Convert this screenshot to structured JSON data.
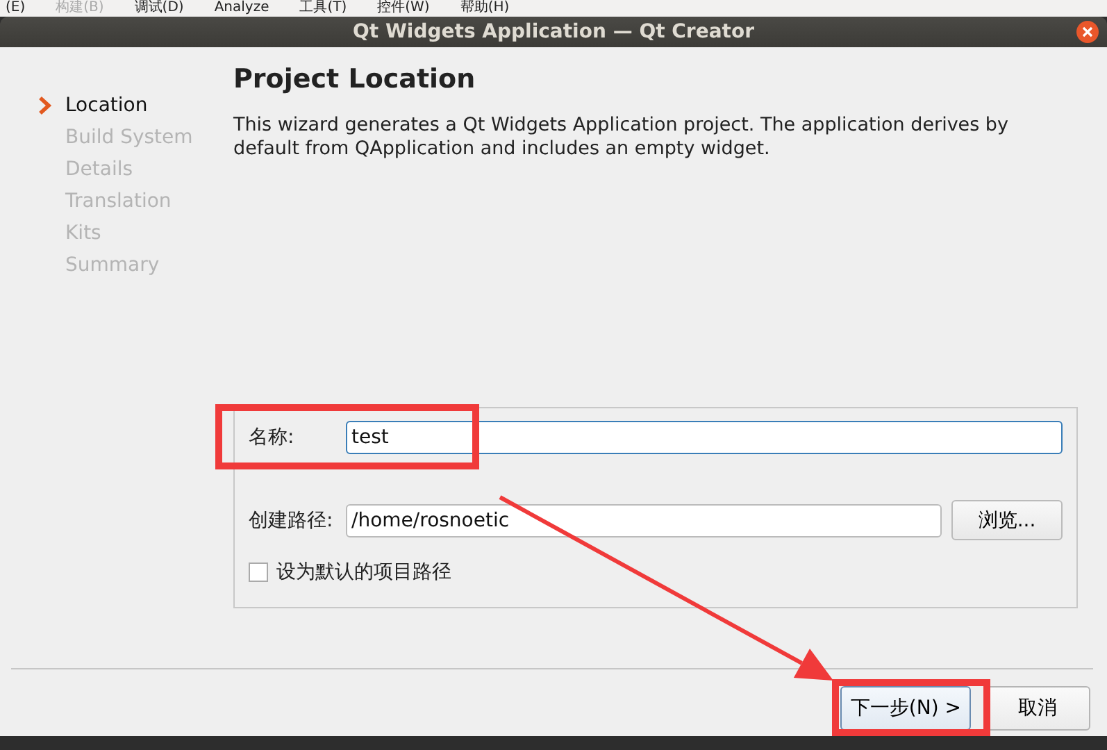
{
  "menu_bar": [
    {
      "label": "(E)",
      "disabled": false
    },
    {
      "label": "构建(B)",
      "disabled": true
    },
    {
      "label": "调试(D)",
      "disabled": false
    },
    {
      "label": "Analyze",
      "disabled": false
    },
    {
      "label": "工具(T)",
      "disabled": false
    },
    {
      "label": "控件(W)",
      "disabled": false
    },
    {
      "label": "帮助(H)",
      "disabled": false
    }
  ],
  "window": {
    "title": "Qt Widgets Application — Qt Creator"
  },
  "steps": [
    {
      "label": "Location",
      "selected": true
    },
    {
      "label": "Build System",
      "selected": false
    },
    {
      "label": "Details",
      "selected": false
    },
    {
      "label": "Translation",
      "selected": false
    },
    {
      "label": "Kits",
      "selected": false
    },
    {
      "label": "Summary",
      "selected": false
    }
  ],
  "page": {
    "heading": "Project Location",
    "description": "This wizard generates a Qt Widgets Application project. The application derives by default from QApplication and includes an empty widget."
  },
  "form": {
    "name_label": "名称:",
    "name_value": "test",
    "path_label": "创建路径:",
    "path_value": "/home/rosnoetic",
    "browse_button": "浏览...",
    "default_checkbox": {
      "label": "设为默认的项目路径",
      "checked": false
    }
  },
  "buttons": [
    {
      "label": "下一步(N) >",
      "kind": "default"
    },
    {
      "label": "取消",
      "kind": "normal"
    }
  ],
  "annotations": [
    {
      "kind": "box",
      "color": "#f03a3a"
    },
    {
      "kind": "arrow",
      "color": "#f03a3a"
    },
    {
      "kind": "box",
      "color": "#f03a3a"
    }
  ]
}
